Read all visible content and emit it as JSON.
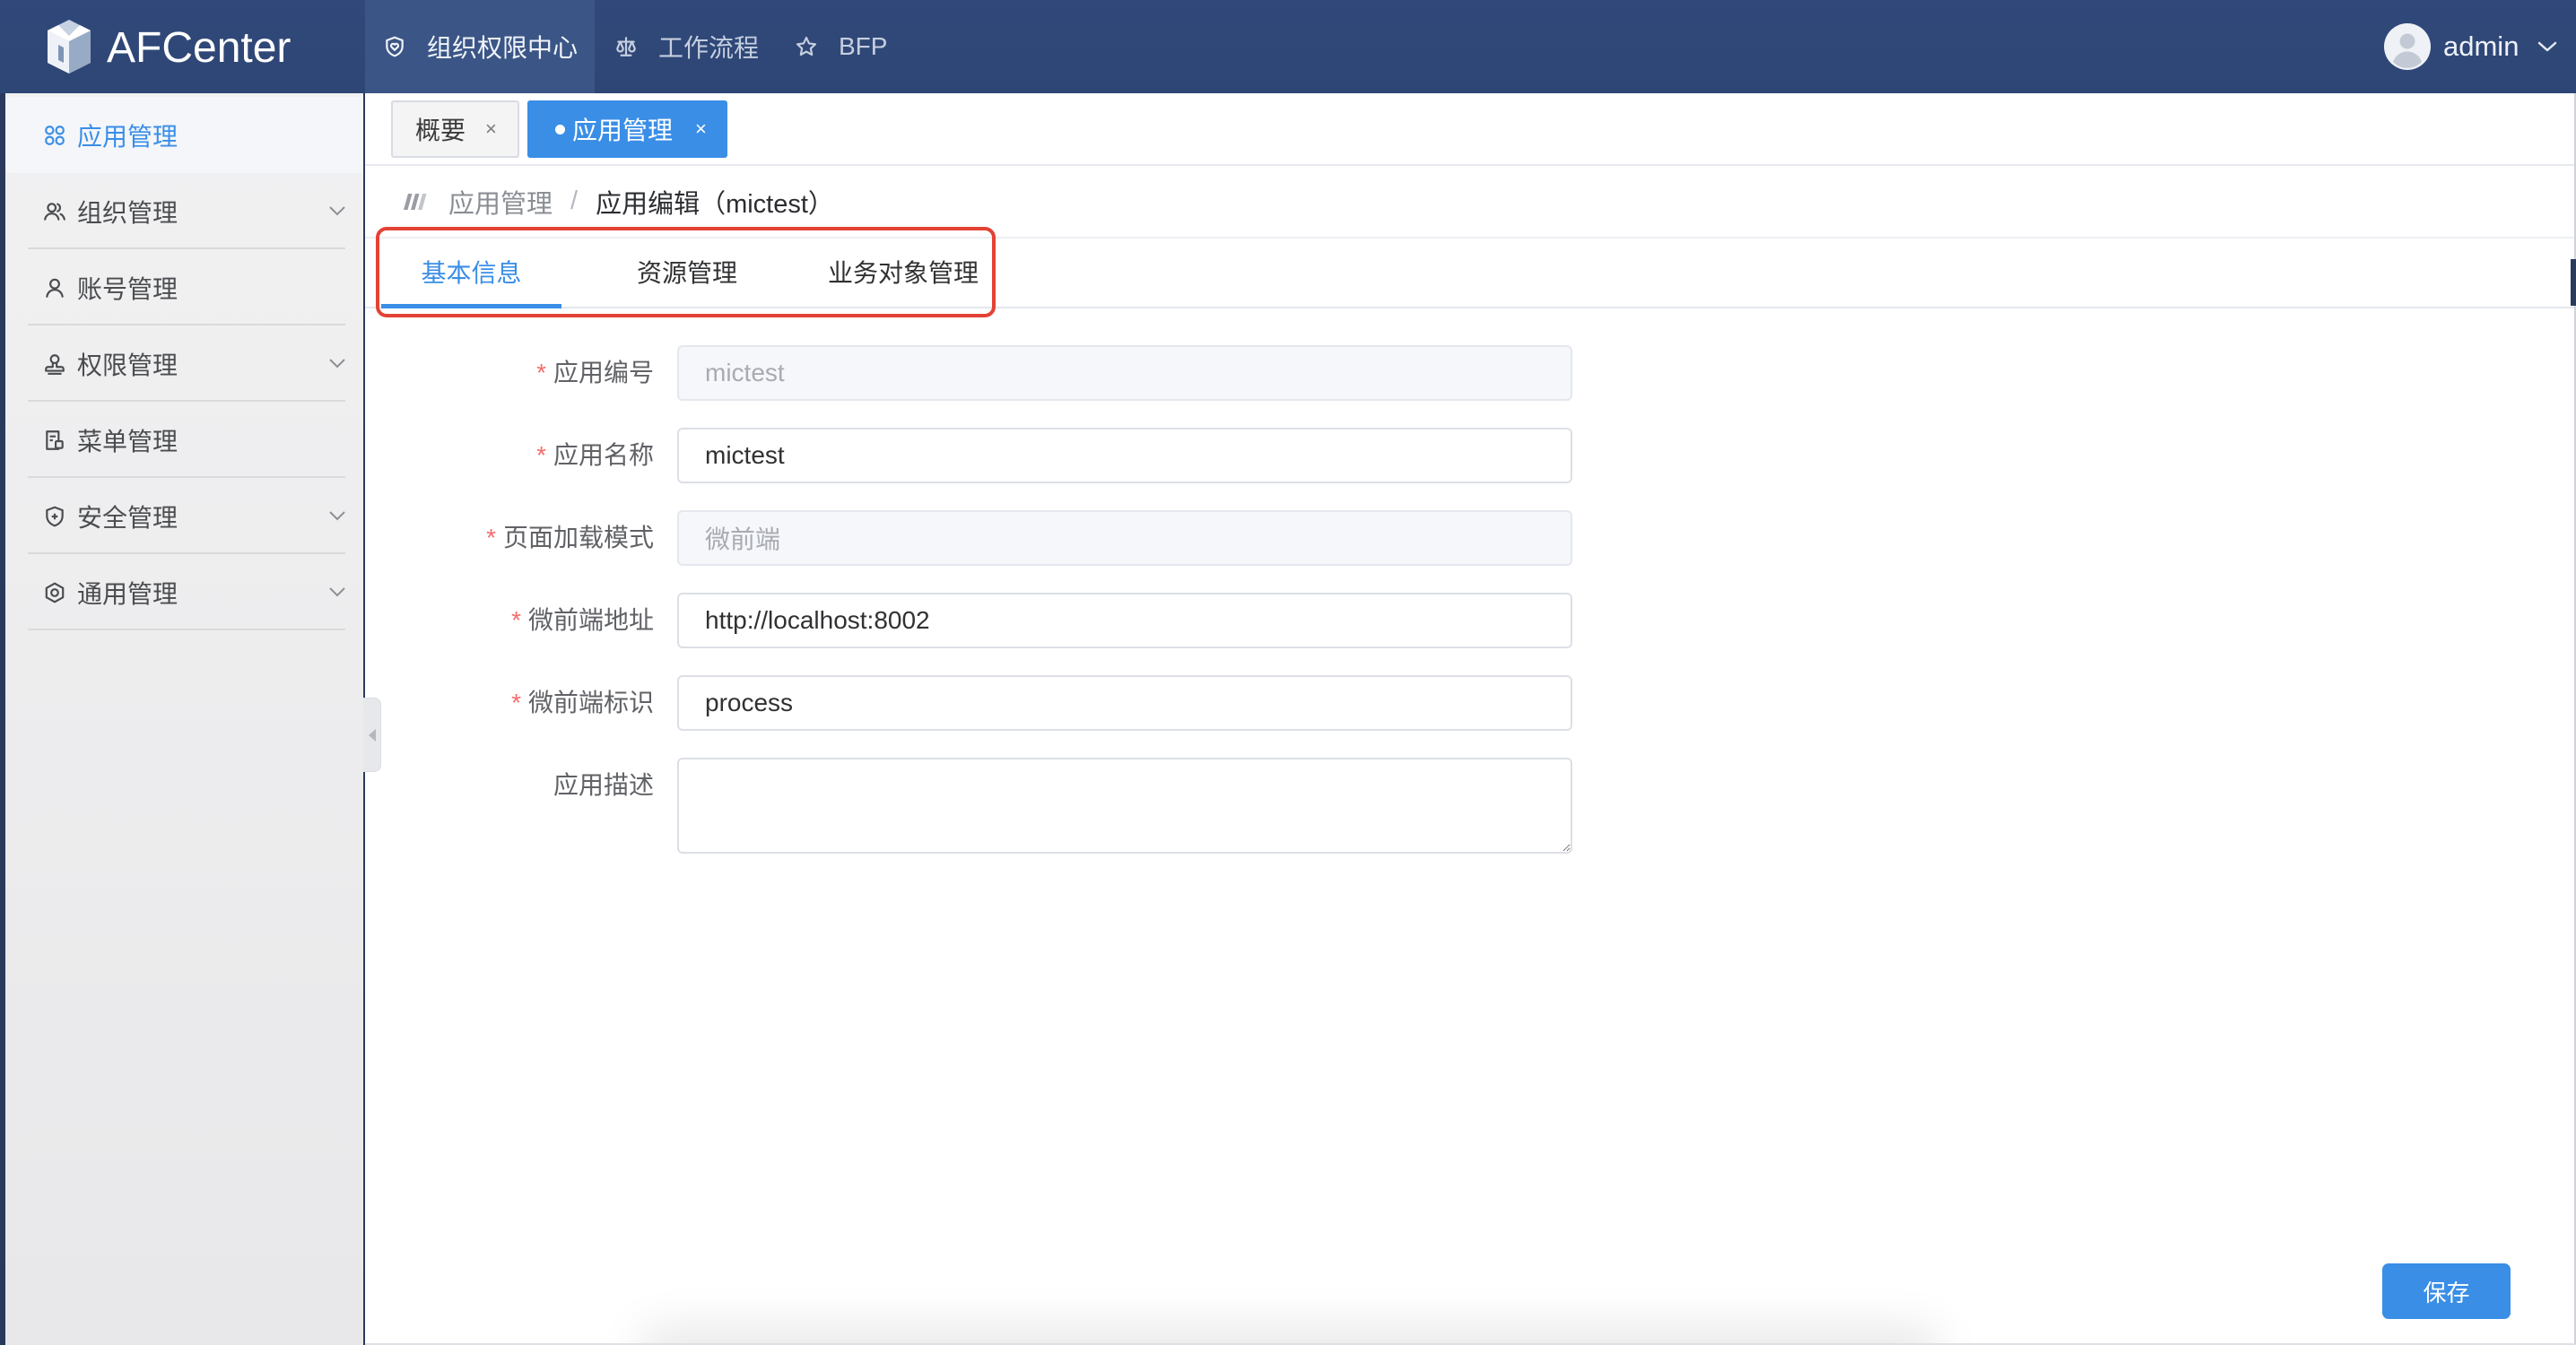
{
  "window": {
    "logo_text": "AFCenter",
    "logo_icon": "afcenter-logo-icon"
  },
  "header": {
    "nav": [
      {
        "label": "组织权限中心",
        "icon": "shield-heart-icon",
        "active": true
      },
      {
        "label": "工作流程",
        "icon": "balance-scale-icon",
        "active": false
      },
      {
        "label": "BFP",
        "icon": "star-icon",
        "active": false
      }
    ],
    "user": {
      "name": "admin",
      "avatar_icon": "user-avatar-icon",
      "dropdown_icon": "chevron-down-icon"
    }
  },
  "sidebar": {
    "items": [
      {
        "label": "应用管理",
        "icon": "grid-icon",
        "active": true,
        "expandable": false
      },
      {
        "label": "组织管理",
        "icon": "users-icon",
        "active": false,
        "expandable": true
      },
      {
        "label": "账号管理",
        "icon": "user-icon",
        "active": false,
        "expandable": false
      },
      {
        "label": "权限管理",
        "icon": "stamp-icon",
        "active": false,
        "expandable": true
      },
      {
        "label": "菜单管理",
        "icon": "menu-doc-icon",
        "active": false,
        "expandable": false
      },
      {
        "label": "安全管理",
        "icon": "shield-plus-icon",
        "active": false,
        "expandable": true
      },
      {
        "label": "通用管理",
        "icon": "settings-icon",
        "active": false,
        "expandable": true
      }
    ],
    "collapse_icon": "caret-left-icon"
  },
  "page_tabs": {
    "close_glyph": "×",
    "tabs": [
      {
        "label": "概要",
        "active": false
      },
      {
        "label": "应用管理",
        "active": true
      }
    ]
  },
  "breadcrumb": {
    "icon": "breadcrumb-icon",
    "separator": "/",
    "items": [
      "应用管理",
      "应用编辑（mictest）"
    ]
  },
  "sub_tabs": {
    "active_index": 0,
    "highlighted": true,
    "items": [
      "基本信息",
      "资源管理",
      "业务对象管理"
    ]
  },
  "form": {
    "required_mark": "*",
    "fields": [
      {
        "label": "应用编号",
        "required": true,
        "disabled": true,
        "value": "mictest"
      },
      {
        "label": "应用名称",
        "required": true,
        "disabled": false,
        "value": "mictest"
      },
      {
        "label": "页面加载模式",
        "required": true,
        "disabled": true,
        "value": "微前端"
      },
      {
        "label": "微前端地址",
        "required": true,
        "disabled": false,
        "value": "http://localhost:8002"
      },
      {
        "label": "微前端标识",
        "required": true,
        "disabled": false,
        "value": "process"
      },
      {
        "label": "应用描述",
        "required": false,
        "disabled": false,
        "value": ""
      }
    ]
  },
  "actions": {
    "save_label": "保存"
  },
  "colors": {
    "header_bg": "#2e4675",
    "header_active_bg": "#3b5686",
    "sidebar_bg": "#e8e8ea",
    "accent": "#3a8ee6",
    "highlight_box": "#e34234",
    "required_star": "#f56c6c"
  }
}
